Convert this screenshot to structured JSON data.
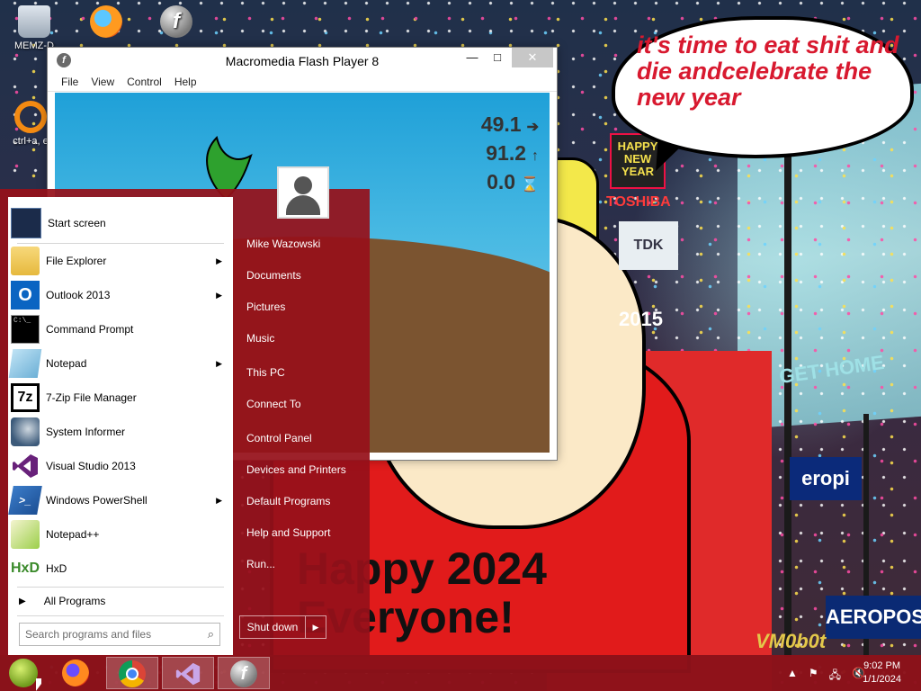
{
  "desktop": {
    "icons": [
      {
        "label": "MEMZ-D",
        "icon": "recycle-bin-icon"
      },
      {
        "label": "",
        "icon": "firefox-shortcut-icon"
      },
      {
        "label": "",
        "icon": "flash-player-shortcut-icon"
      },
      {
        "label": "ctrl+a, e",
        "icon": "orange-ring-shortcut-icon"
      }
    ],
    "speech_bubble": "it's time to eat shit and die andcelebrate the new year",
    "wallpaper_text": "Happy 2024 Everyone!",
    "watermark": "VM0b0t",
    "signs": [
      "HAPPY NEW YEAR",
      "TOSHIBA",
      "TDK",
      "2015",
      "GET HOME",
      "eropi",
      "AEROPOS"
    ]
  },
  "flash_window": {
    "title": "Macromedia Flash Player 8",
    "menu": [
      "File",
      "View",
      "Control",
      "Help"
    ],
    "controls": {
      "minimize": "—",
      "maximize": "□",
      "close": "✕"
    },
    "readouts": [
      {
        "value": "49.1",
        "arrow": "➔"
      },
      {
        "value": "91.2",
        "arrow": "↑"
      },
      {
        "value": "0.0",
        "arrow": "⌛"
      }
    ]
  },
  "start_menu": {
    "programs": [
      {
        "label": "Start screen",
        "icon": "start-screen-icon",
        "submenu": false
      },
      {
        "label": "File Explorer",
        "icon": "file-explorer-icon",
        "submenu": true
      },
      {
        "label": "Outlook 2013",
        "icon": "outlook-icon",
        "submenu": true
      },
      {
        "label": "Command Prompt",
        "icon": "command-prompt-icon",
        "submenu": false
      },
      {
        "label": "Notepad",
        "icon": "notepad-icon",
        "submenu": true
      },
      {
        "label": "7-Zip File Manager",
        "icon": "seven-zip-icon",
        "submenu": false
      },
      {
        "label": "System Informer",
        "icon": "system-informer-icon",
        "submenu": false
      },
      {
        "label": "Visual Studio 2013",
        "icon": "visual-studio-icon",
        "submenu": false
      },
      {
        "label": "Windows PowerShell",
        "icon": "powershell-icon",
        "submenu": true
      },
      {
        "label": "Notepad++",
        "icon": "notepadpp-icon",
        "submenu": false
      },
      {
        "label": "HxD",
        "icon": "hxd-icon",
        "submenu": false
      }
    ],
    "all_programs": "All Programs",
    "search_placeholder": "Search programs and files",
    "user_name": "Mike Wazowski",
    "places": [
      "Documents",
      "Pictures",
      "Music",
      "This PC",
      "Connect To",
      "Control Panel",
      "Devices and Printers",
      "Default Programs",
      "Help and Support",
      "Run..."
    ],
    "shutdown_label": "Shut down",
    "shutdown_arrow": "▶"
  },
  "taskbar": {
    "pinned": [
      {
        "name": "firefox",
        "icon": "firefox-icon"
      },
      {
        "name": "chrome",
        "icon": "chrome-icon"
      },
      {
        "name": "visual studio",
        "icon": "visual-studio-icon"
      },
      {
        "name": "flash player",
        "icon": "flash-player-icon"
      }
    ],
    "tray": [
      "▲",
      "⚑",
      "🖧",
      "🔇"
    ],
    "time": "9:02 PM",
    "date": "1/1/2024"
  },
  "colors": {
    "start_menu_bg": "#96101a",
    "taskbar_bg": "#8c121a",
    "flash_sky": "#1fa0d8",
    "flash_ground": "#7b5430",
    "bubble_text": "#d8192f"
  }
}
